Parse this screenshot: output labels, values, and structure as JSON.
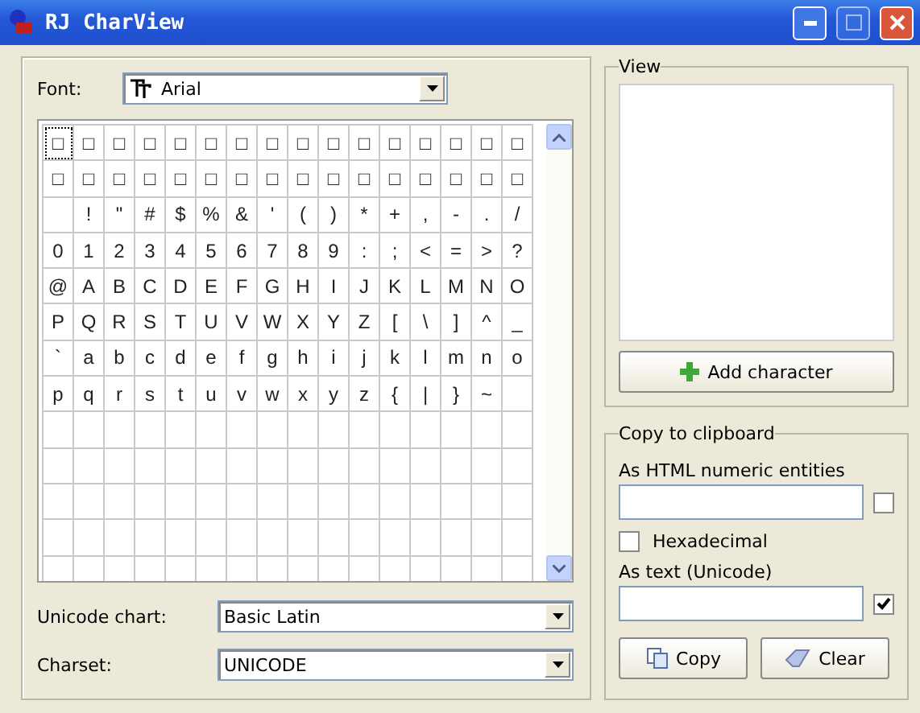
{
  "window": {
    "title": "RJ CharView"
  },
  "font": {
    "label": "Font:",
    "value": "Arial"
  },
  "grid": {
    "rows": [
      [
        "□",
        "□",
        "□",
        "□",
        "□",
        "□",
        "□",
        "□",
        "□",
        "□",
        "□",
        "□",
        "□",
        "□",
        "□",
        "□"
      ],
      [
        "□",
        "□",
        "□",
        "□",
        "□",
        "□",
        "□",
        "□",
        "□",
        "□",
        "□",
        "□",
        "□",
        "□",
        "□",
        "□"
      ],
      [
        null,
        "!",
        "\"",
        "#",
        "$",
        "%",
        "&",
        "'",
        "(",
        ")",
        "*",
        "+",
        ",",
        "-",
        ".",
        "/"
      ],
      [
        "0",
        "1",
        "2",
        "3",
        "4",
        "5",
        "6",
        "7",
        "8",
        "9",
        ":",
        ";",
        "<",
        "=",
        ">",
        "?"
      ],
      [
        "@",
        "A",
        "B",
        "C",
        "D",
        "E",
        "F",
        "G",
        "H",
        "I",
        "J",
        "K",
        "L",
        "M",
        "N",
        "O"
      ],
      [
        "P",
        "Q",
        "R",
        "S",
        "T",
        "U",
        "V",
        "W",
        "X",
        "Y",
        "Z",
        "[",
        "\\",
        "]",
        "^",
        "_"
      ],
      [
        "`",
        "a",
        "b",
        "c",
        "d",
        "e",
        "f",
        "g",
        "h",
        "i",
        "j",
        "k",
        "l",
        "m",
        "n",
        "o"
      ],
      [
        "p",
        "q",
        "r",
        "s",
        "t",
        "u",
        "v",
        "w",
        "x",
        "y",
        "z",
        "{",
        "|",
        "}",
        "~",
        null
      ]
    ]
  },
  "unicode_chart": {
    "label": "Unicode chart:",
    "value": "Basic Latin"
  },
  "charset": {
    "label": "Charset:",
    "value": "UNICODE"
  },
  "view": {
    "title": "View",
    "add_button": "Add character"
  },
  "clipboard": {
    "title": "Copy to clipboard",
    "html_label": "As HTML numeric entities",
    "html_checked": false,
    "hex_label": "Hexadecimal",
    "hex_checked": false,
    "text_label": "As text (Unicode)",
    "text_checked": true,
    "copy_button": "Copy",
    "clear_button": "Clear"
  }
}
